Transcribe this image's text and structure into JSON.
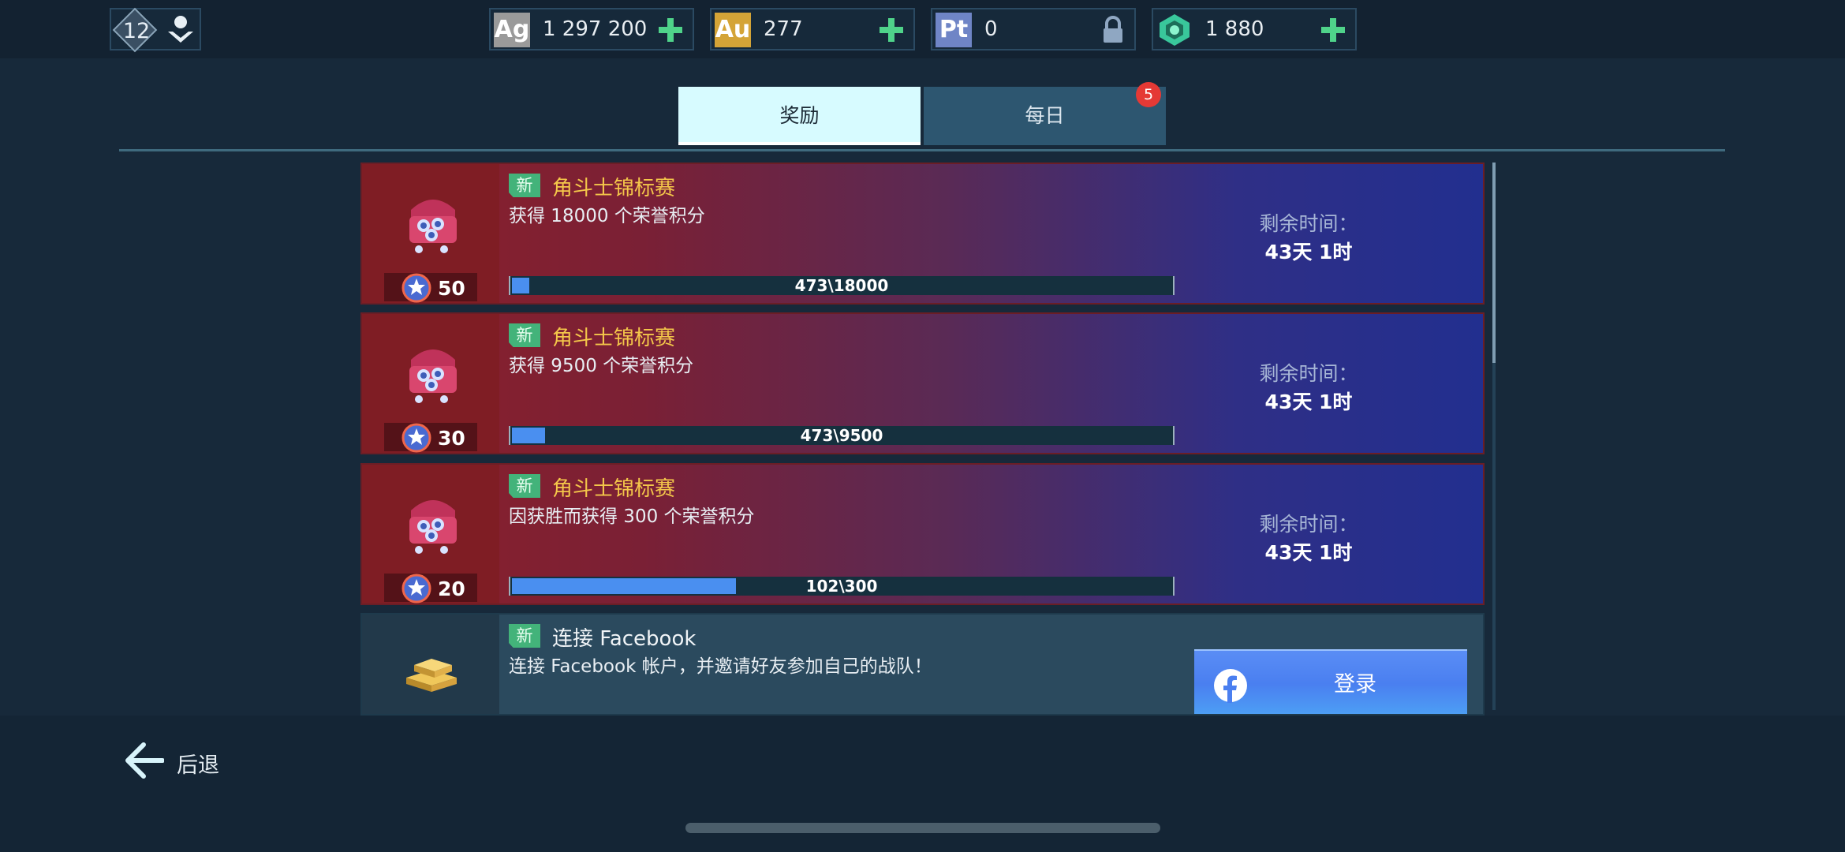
{
  "player": {
    "level": "12"
  },
  "currencies": [
    {
      "code": "Ag",
      "value": "1 297 200",
      "color": "#9a9a9a",
      "action": "plus"
    },
    {
      "code": "Au",
      "value": "277",
      "color": "#d4a437",
      "action": "plus"
    },
    {
      "code": "Pt",
      "value": "0",
      "color": "#6f85c6",
      "action": "lock"
    },
    {
      "code": "gem",
      "value": "1 880",
      "color": "#39c79b",
      "action": "plus"
    }
  ],
  "tabs": [
    {
      "label": "奖励",
      "active": true
    },
    {
      "label": "每日",
      "badge": "5"
    }
  ],
  "quests": [
    {
      "new_tag": "新",
      "title": "角斗士锦标赛",
      "description": "获得 18000 个荣誉积分",
      "reward": "50",
      "progress_text": "473\\18000",
      "progress": 0.026,
      "time_label": "剩余时间：",
      "time_value": "43天 1时"
    },
    {
      "new_tag": "新",
      "title": "角斗士锦标赛",
      "description": "获得 9500 个荣誉积分",
      "reward": "30",
      "progress_text": "473\\9500",
      "progress": 0.05,
      "time_label": "剩余时间：",
      "time_value": "43天 1时"
    },
    {
      "new_tag": "新",
      "title": "角斗士锦标赛",
      "description": "因获胜而获得 300 个荣誉积分",
      "reward": "20",
      "progress_text": "102\\300",
      "progress": 0.34,
      "time_label": "剩余时间：",
      "time_value": "43天 1时"
    }
  ],
  "facebook": {
    "new_tag": "新",
    "title": "连接 Facebook",
    "description": "连接 Facebook 帐户，并邀请好友参加自己的战队！",
    "button_label": "登录"
  },
  "back_label": "后退",
  "colors": {
    "accent_green": "#4fd38a",
    "progress_fill": "#4a8ff0",
    "tab_active": "#d7fbff",
    "badge_red": "#e53935"
  }
}
